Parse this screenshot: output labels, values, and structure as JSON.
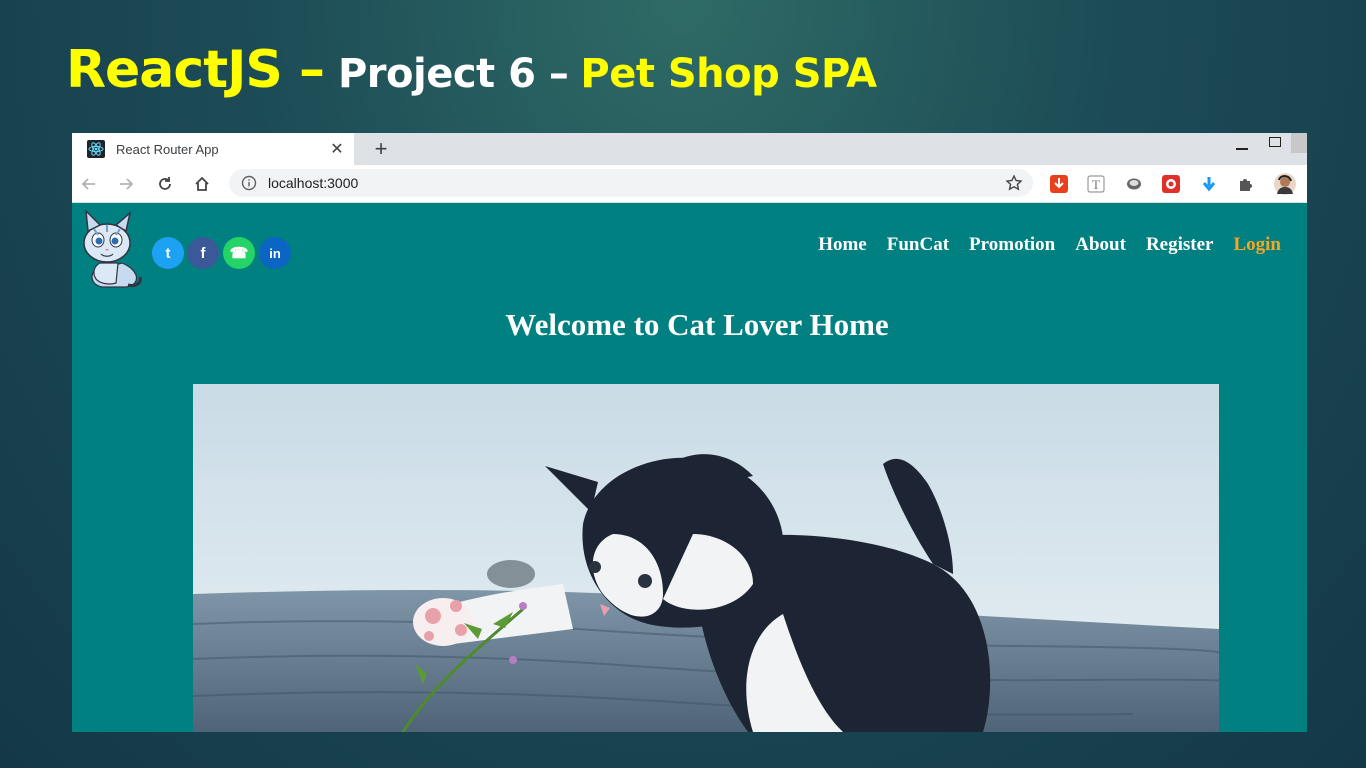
{
  "slide": {
    "title_part1": "ReactJS –",
    "title_part2": "Project 6 –",
    "title_part3": "Pet Shop SPA"
  },
  "browser": {
    "tab_title": "React Router App",
    "tab_favicon": "react-icon",
    "url": "localhost:3000",
    "extensions": [
      "download-extension-icon",
      "text-extension-icon",
      "circle-extension-icon",
      "red-extension-icon",
      "blue-arrow-extension-icon",
      "puzzle-icon",
      "profile-avatar"
    ]
  },
  "site": {
    "social": [
      {
        "name": "twitter",
        "glyph": "t",
        "color": "#1da1f2"
      },
      {
        "name": "facebook",
        "glyph": "f",
        "color": "#3b5998"
      },
      {
        "name": "whatsapp",
        "glyph": "☎",
        "color": "#25d366"
      },
      {
        "name": "linkedin",
        "glyph": "in",
        "color": "#0a66c2"
      }
    ],
    "nav": {
      "home": "Home",
      "funcat": "FunCat",
      "promotion": "Promotion",
      "about": "About",
      "register": "Register",
      "login": "Login"
    },
    "active_color": "#f5a623",
    "background": "#008080",
    "welcome": "Welcome to Cat Lover Home"
  }
}
